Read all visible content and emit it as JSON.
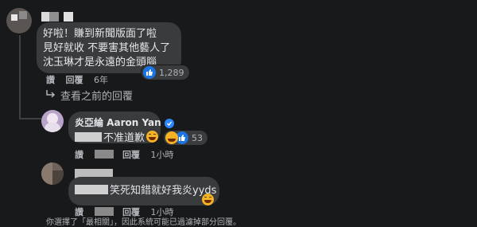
{
  "comment1": {
    "lines": [
      "好啦！賺到新聞版面了啦",
      "見好就收 不要害其他藝人了",
      "沈玉琳才是永遠的金頭腦"
    ],
    "reaction_count": "1,289",
    "actions": {
      "like": "讚",
      "reply": "回覆",
      "time": "6年"
    }
  },
  "view_previous": {
    "label": "查看之前的回覆"
  },
  "reply1": {
    "author": "炎亞綸 Aaron Yan",
    "text": "不准道歉",
    "reaction_count": "53",
    "actions": {
      "like": "讚",
      "reply": "回覆",
      "time": "1小時"
    }
  },
  "reply2": {
    "text": "笑死知錯就好我炎yyds",
    "actions": {
      "like": "讚",
      "reply": "回覆",
      "time": "1小時"
    }
  },
  "notice": {
    "text": "你選擇了「最相關」，因此系統可能已過濾掉部分回覆。"
  },
  "colors": {
    "background": "#18191a",
    "bubble": "#3a3b3c",
    "accent": "#1b74e4",
    "secondary_text": "#b0b3b8"
  }
}
